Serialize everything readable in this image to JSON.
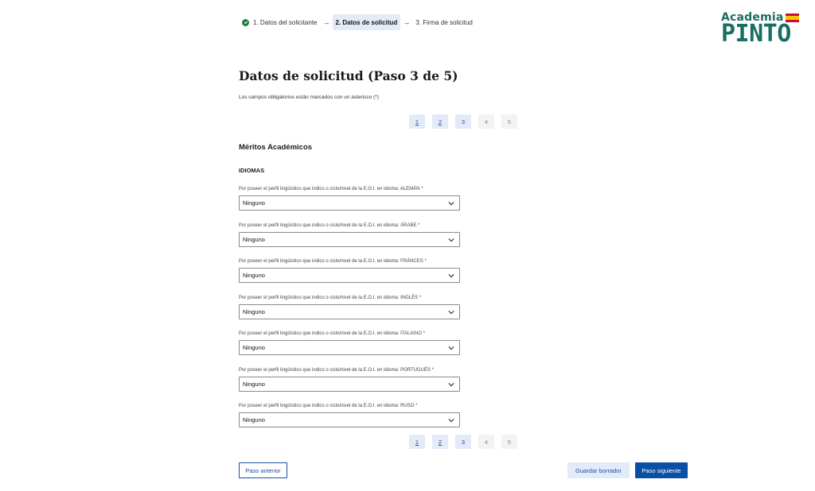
{
  "stepper": {
    "steps": [
      {
        "label": "1. Datos del solicitante",
        "status": "completed"
      },
      {
        "label": "2. Datos de solicitud",
        "status": "active"
      },
      {
        "label": "3. Firma de solicitud",
        "status": "pending"
      }
    ],
    "arrow": "→"
  },
  "logo": {
    "top": "Academia",
    "bottom": "PINTO"
  },
  "page": {
    "title": "Datos de solicitud (Paso 3 de 5)",
    "required_note": "Los campos obligatorios están marcados con un asterisco (*)"
  },
  "pagination": {
    "pages": [
      "1",
      "2",
      "3",
      "4",
      "5"
    ],
    "current": "3"
  },
  "section": {
    "title": "Méritos Académicos",
    "subtitle": "IDIOMAS"
  },
  "fields": [
    {
      "label": "Por poseer el perfil lingüístico que indico o ciclo/nivel de la E.O.I. en idioma: ALEMÁN",
      "value": "Ninguno"
    },
    {
      "label": "Por poseer el perfil lingüístico que indico o ciclo/nivel de la E.O.I. en idioma: ÁRABE",
      "value": "Ninguno"
    },
    {
      "label": "Por poseer el perfil lingüístico que indico o ciclo/nivel de la E.O.I. en idioma: FRÁNCES",
      "value": "Ninguno"
    },
    {
      "label": "Por poseer el perfil lingüístico que indico o ciclo/nivel de la E.O.I. en idioma: INGLÉS",
      "value": "Ninguno"
    },
    {
      "label": "Por poseer el perfil lingüístico que indico o ciclo/nivel de la E.O.I. en idioma: ITALIANO",
      "value": "Ninguno"
    },
    {
      "label": "Por poseer el perfil lingüístico que indico o ciclo/nivel de la E.O.I. en idioma: PORTUGUÉS",
      "value": "Ninguno"
    },
    {
      "label": "Por poseer el perfil lingüístico que indico o ciclo/nivel de la E.O.I. en idioma: RUSO",
      "value": "Ninguno"
    }
  ],
  "required_marker": "*",
  "buttons": {
    "previous": "Paso anterior",
    "save_draft": "Guardar borrador",
    "next": "Paso siguiente"
  },
  "icons": {
    "completed": "check-circle-icon",
    "arrow": "arrow-right-icon",
    "select": "chevron-down-icon"
  },
  "colors": {
    "primary": "#0a4fa6",
    "success": "#1b7f3b",
    "required": "#c8102e",
    "brand": "#1a6e63"
  }
}
